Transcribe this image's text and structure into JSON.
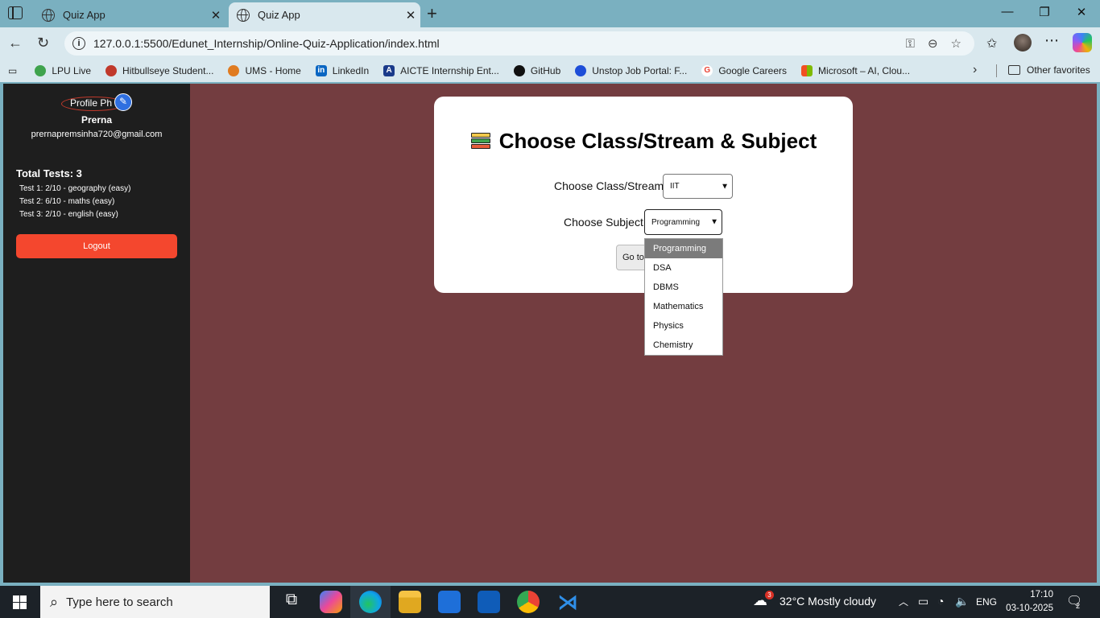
{
  "browser": {
    "tabs": [
      {
        "title": "Quiz App",
        "active": false
      },
      {
        "title": "Quiz App",
        "active": true
      }
    ],
    "url": "127.0.0.1:5500/Edunet_Internship/Online-Quiz-Application/index.html",
    "bookmarks": [
      {
        "label": "LPU Live",
        "icon": "lpu-icon",
        "color": "#3fa34d"
      },
      {
        "label": "Hitbullseye Student...",
        "icon": "hitbullseye-icon",
        "color": "#c0392b"
      },
      {
        "label": "UMS - Home",
        "icon": "ums-icon",
        "color": "#e07b20"
      },
      {
        "label": "LinkedIn",
        "icon": "linkedin-icon",
        "color": "#0a66c2"
      },
      {
        "label": "AICTE Internship Ent...",
        "icon": "aicte-icon",
        "color": "#1a3a8a"
      },
      {
        "label": "GitHub",
        "icon": "github-icon",
        "color": "#111111"
      },
      {
        "label": "Unstop Job Portal: F...",
        "icon": "unstop-icon",
        "color": "#1d4ed8"
      },
      {
        "label": "Google Careers",
        "icon": "google-icon",
        "color": "#ea4335"
      },
      {
        "label": "Microsoft – AI, Clou...",
        "icon": "microsoft-icon",
        "color": "#f25022"
      }
    ],
    "other_favorites": "Other favorites"
  },
  "sidebar": {
    "profile_alt": "Profile Ph",
    "name": "Prerna",
    "email": "prernapremsinha720@gmail.com",
    "total_tests": "Total Tests: 3",
    "tests": [
      "Test 1: 2/10 - geography (easy)",
      "Test 2: 6/10 - maths (easy)",
      "Test 3: 2/10 - english (easy)"
    ],
    "logout_label": "Logout"
  },
  "main": {
    "title": "Choose Class/Stream & Subject",
    "class_label": "Choose Class/Stream:",
    "class_value": "IIT",
    "subject_label": "Choose Subject:",
    "subject_value": "Programming",
    "go_button": "Go to Quiz",
    "subject_options": [
      "Programming",
      "DSA",
      "DBMS",
      "Mathematics",
      "Physics",
      "Chemistry"
    ],
    "selected_option": "Programming"
  },
  "taskbar": {
    "search_placeholder": "Type here to search",
    "weather": "32°C  Mostly cloudy",
    "weather_badge": "3",
    "language": "ENG",
    "time": "17:10",
    "date": "03-10-2025",
    "notification_count": "2"
  },
  "colors": {
    "page_background": "#733d40",
    "sidebar": "#1e1e1e",
    "logout": "#f4472e",
    "browser_frame": "#7ab0c0"
  }
}
